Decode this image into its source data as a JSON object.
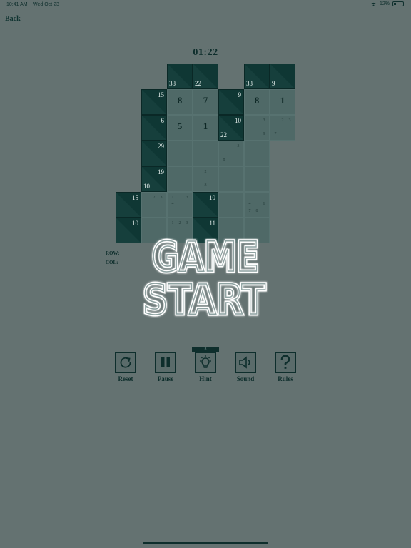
{
  "status_bar": {
    "time": "10:41 AM",
    "date": "Wed Oct 23",
    "battery": "12%"
  },
  "nav": {
    "back_label": "Back"
  },
  "timer": "01:22",
  "board": {
    "cells": [
      {
        "r": 0,
        "c": 2,
        "type": "clue",
        "down": "38"
      },
      {
        "r": 0,
        "c": 3,
        "type": "clue",
        "down": "22"
      },
      {
        "r": 0,
        "c": 5,
        "type": "clue",
        "down": "33"
      },
      {
        "r": 0,
        "c": 6,
        "type": "clue",
        "down": "9"
      },
      {
        "r": 1,
        "c": 1,
        "type": "clue",
        "right": "15"
      },
      {
        "r": 1,
        "c": 2,
        "type": "white",
        "value": "8"
      },
      {
        "r": 1,
        "c": 3,
        "type": "white",
        "value": "7"
      },
      {
        "r": 1,
        "c": 4,
        "type": "clue",
        "right": "9"
      },
      {
        "r": 1,
        "c": 5,
        "type": "white",
        "value": "8"
      },
      {
        "r": 1,
        "c": 6,
        "type": "white",
        "value": "1"
      },
      {
        "r": 2,
        "c": 1,
        "type": "clue",
        "right": "6"
      },
      {
        "r": 2,
        "c": 2,
        "type": "white",
        "value": "5"
      },
      {
        "r": 2,
        "c": 3,
        "type": "white",
        "value": "1"
      },
      {
        "r": 2,
        "c": 4,
        "type": "clue",
        "right": "10",
        "down": "22"
      },
      {
        "r": 2,
        "c": 5,
        "type": "white",
        "notes": [
          "",
          "",
          "3",
          "",
          "",
          "",
          "",
          "",
          "9"
        ]
      },
      {
        "r": 2,
        "c": 6,
        "type": "white",
        "notes": [
          "",
          "2",
          "3",
          "",
          "",
          "",
          "7",
          "",
          ""
        ]
      },
      {
        "r": 3,
        "c": 1,
        "type": "clue",
        "right": "29"
      },
      {
        "r": 3,
        "c": 2,
        "type": "white"
      },
      {
        "r": 3,
        "c": 3,
        "type": "white"
      },
      {
        "r": 3,
        "c": 4,
        "type": "white",
        "notes": [
          "",
          "",
          "3",
          "",
          "",
          "",
          "8",
          "",
          ""
        ]
      },
      {
        "r": 3,
        "c": 5,
        "type": "white"
      },
      {
        "r": 4,
        "c": 1,
        "type": "clue",
        "right": "19",
        "down": "10"
      },
      {
        "r": 4,
        "c": 2,
        "type": "white"
      },
      {
        "r": 4,
        "c": 3,
        "type": "white",
        "notes": [
          "",
          "2",
          "",
          "",
          "",
          "",
          "",
          "8",
          ""
        ]
      },
      {
        "r": 4,
        "c": 4,
        "type": "white"
      },
      {
        "r": 4,
        "c": 5,
        "type": "white"
      },
      {
        "r": 5,
        "c": 0,
        "type": "clue",
        "right": "15"
      },
      {
        "r": 5,
        "c": 1,
        "type": "white",
        "notes": [
          "",
          "2",
          "3",
          "",
          "",
          "",
          "",
          "",
          ""
        ]
      },
      {
        "r": 5,
        "c": 2,
        "type": "white",
        "notes": [
          "1",
          "",
          "3",
          "4",
          "",
          "",
          "",
          "",
          ""
        ]
      },
      {
        "r": 5,
        "c": 3,
        "type": "clue",
        "right": "10"
      },
      {
        "r": 5,
        "c": 4,
        "type": "white"
      },
      {
        "r": 5,
        "c": 5,
        "type": "white",
        "notes": [
          "",
          "",
          "",
          "4",
          "",
          "6",
          "7",
          "8",
          ""
        ]
      },
      {
        "r": 6,
        "c": 0,
        "type": "clue",
        "right": "10"
      },
      {
        "r": 6,
        "c": 1,
        "type": "white"
      },
      {
        "r": 6,
        "c": 2,
        "type": "white",
        "notes": [
          "1",
          "2",
          "3",
          "",
          "",
          "",
          "",
          "",
          ""
        ]
      },
      {
        "r": 6,
        "c": 3,
        "type": "clue",
        "right": "11"
      },
      {
        "r": 6,
        "c": 4,
        "type": "white"
      },
      {
        "r": 6,
        "c": 5,
        "type": "white"
      }
    ]
  },
  "info": {
    "row_label": "ROW:",
    "col_label": "COL:"
  },
  "overlay": {
    "line1": "GAME",
    "line2": "START"
  },
  "toolbar": {
    "hint_count": "8",
    "buttons": [
      {
        "label": "Reset",
        "icon": "reset-icon"
      },
      {
        "label": "Pause",
        "icon": "pause-icon"
      },
      {
        "label": "Hint",
        "icon": "lightbulb-icon"
      },
      {
        "label": "Sound",
        "icon": "speaker-icon"
      },
      {
        "label": "Rules",
        "icon": "question-mark-icon"
      }
    ]
  }
}
